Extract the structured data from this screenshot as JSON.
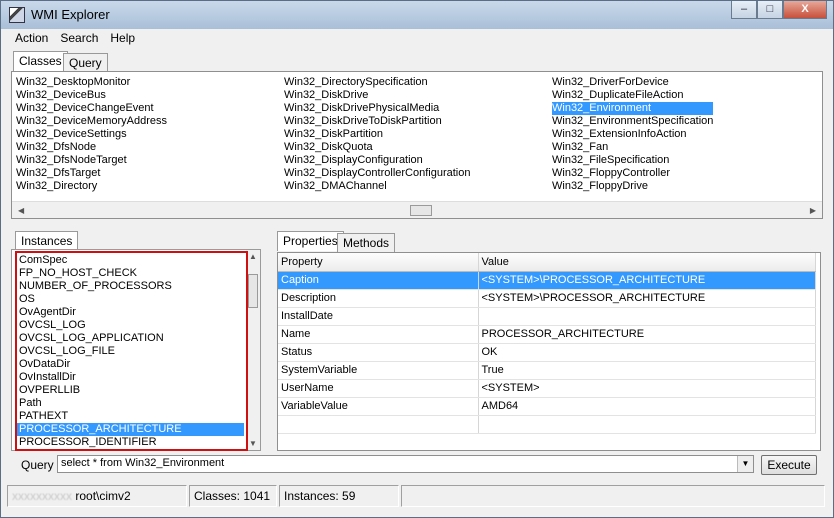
{
  "window": {
    "title": "WMI Explorer",
    "caption_buttons": [
      "–",
      "□",
      "X"
    ]
  },
  "menu": {
    "items": [
      "Action",
      "Search",
      "Help"
    ]
  },
  "top_tabs": {
    "classes": "Classes",
    "query": "Query"
  },
  "classes": {
    "columns": [
      [
        "Win32_DesktopMonitor",
        "Win32_DeviceBus",
        "Win32_DeviceChangeEvent",
        "Win32_DeviceMemoryAddress",
        "Win32_DeviceSettings",
        "Win32_DfsNode",
        "Win32_DfsNodeTarget",
        "Win32_DfsTarget",
        "Win32_Directory"
      ],
      [
        "Win32_DirectorySpecification",
        "Win32_DiskDrive",
        "Win32_DiskDrivePhysicalMedia",
        "Win32_DiskDriveToDiskPartition",
        "Win32_DiskPartition",
        "Win32_DiskQuota",
        "Win32_DisplayConfiguration",
        "Win32_DisplayControllerConfiguration",
        "Win32_DMAChannel"
      ],
      [
        "Win32_DriverForDevice",
        "Win32_DuplicateFileAction",
        "Win32_Environment",
        "Win32_EnvironmentSpecification",
        "Win32_ExtensionInfoAction",
        "Win32_Fan",
        "Win32_FileSpecification",
        "Win32_FloppyController",
        "Win32_FloppyDrive"
      ]
    ],
    "selected": "Win32_Environment"
  },
  "instances": {
    "tab_label": "Instances",
    "items": [
      "ComSpec",
      "FP_NO_HOST_CHECK",
      "NUMBER_OF_PROCESSORS",
      "OS",
      "OvAgentDir",
      "OVCSL_LOG",
      "OVCSL_LOG_APPLICATION",
      "OVCSL_LOG_FILE",
      "OvDataDir",
      "OvInstallDir",
      "OVPERLLIB",
      "Path",
      "PATHEXT",
      "PROCESSOR_ARCHITECTURE",
      "PROCESSOR_IDENTIFIER"
    ],
    "selected": "PROCESSOR_ARCHITECTURE"
  },
  "details": {
    "tabs": [
      "Properties",
      "Methods"
    ],
    "headers": [
      "Property",
      "Value"
    ],
    "rows": [
      [
        "Caption",
        "<SYSTEM>\\PROCESSOR_ARCHITECTURE"
      ],
      [
        "Description",
        "<SYSTEM>\\PROCESSOR_ARCHITECTURE"
      ],
      [
        "InstallDate",
        ""
      ],
      [
        "Name",
        "PROCESSOR_ARCHITECTURE"
      ],
      [
        "Status",
        "OK"
      ],
      [
        "SystemVariable",
        "True"
      ],
      [
        "UserName",
        "<SYSTEM>"
      ],
      [
        "VariableValue",
        "AMD64"
      ]
    ],
    "selected_row": "Caption"
  },
  "query": {
    "label": "Query",
    "value": "select * from Win32_Environment",
    "execute_label": "Execute"
  },
  "status": {
    "machine": "xxxxxxxxxx",
    "namespace": "root\\cimv2",
    "classes": "Classes: 1041",
    "instances": "Instances: 59"
  },
  "colors": {
    "selection": "#3399ff",
    "highlight_box": "#d01010"
  }
}
